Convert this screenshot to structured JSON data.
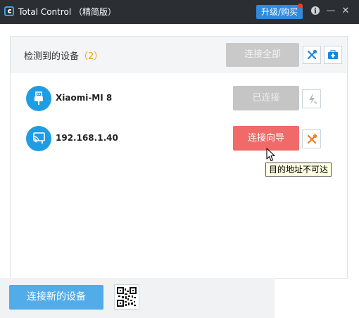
{
  "window": {
    "title": "Total Control （精简版）",
    "upgrade_label": "升级/购买",
    "info_glyph": "i",
    "minimize_glyph": "—",
    "close_glyph": "✕"
  },
  "header": {
    "detected_label": "检测到的设备",
    "detected_count": "（2）",
    "connect_all_label": "连接全部"
  },
  "devices": [
    {
      "name": "Xiaomi-MI 8",
      "type": "usb",
      "action_label": "已连接",
      "action_state": "disabled",
      "side_icon": "flash-icon"
    },
    {
      "name": "192.168.1.40",
      "type": "wifi",
      "action_label": "连接向导",
      "action_state": "active",
      "side_icon": "tools-icon"
    }
  ],
  "tooltip": {
    "text": "目的地址不可达"
  },
  "footer": {
    "new_device_label": "连接新的设备"
  },
  "colors": {
    "accent": "#1e9de3",
    "wizard": "#f06a6a",
    "warning": "#f07c1f",
    "count": "#f5a200"
  }
}
